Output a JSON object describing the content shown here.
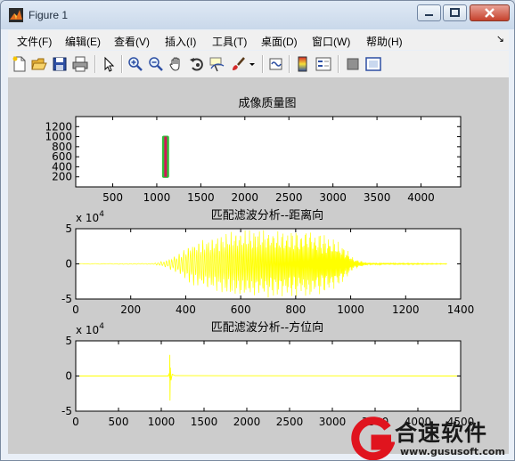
{
  "window": {
    "title": "Figure 1"
  },
  "menu": [
    "文件(F)",
    "编辑(E)",
    "查看(V)",
    "插入(I)",
    "工具(T)",
    "桌面(D)",
    "窗口(W)",
    "帮助(H)"
  ],
  "colors": {
    "signal": "#ffff00",
    "axes_bg": "#ffffff",
    "figure_bg": "#cccccc",
    "image_magenta": "#d4145a",
    "image_green": "#2fbf3a"
  },
  "chart_data": [
    {
      "type": "heatmap",
      "title": "成像质量图",
      "xticks": [
        "500",
        "1000",
        "1500",
        "2000",
        "2500",
        "3000",
        "3500",
        "4000"
      ],
      "yticks": [
        "200",
        "400",
        "600",
        "800",
        "1000",
        "1200"
      ],
      "xlim": [
        80,
        4450
      ],
      "ylim": [
        0,
        1400
      ],
      "blob": {
        "x": [
          1060,
          1140
        ],
        "y": [
          180,
          1020
        ],
        "core_x": [
          1085,
          1115
        ]
      }
    },
    {
      "type": "line",
      "title": "匹配滤波分析--距离向",
      "exponent_label": "x 10",
      "exponent": "4",
      "xticks": [
        "0",
        "200",
        "400",
        "600",
        "800",
        "1000",
        "1200",
        "1400"
      ],
      "yticks": [
        "-5",
        "0",
        "5"
      ],
      "xlim": [
        0,
        1400
      ],
      "ylim": [
        -5,
        5
      ],
      "signal_range": [
        0,
        1350
      ],
      "envelope": [
        [
          0,
          0.04
        ],
        [
          280,
          0.06
        ],
        [
          330,
          0.5
        ],
        [
          380,
          1.6
        ],
        [
          420,
          3.0
        ],
        [
          480,
          3.6
        ],
        [
          520,
          4.0
        ],
        [
          560,
          4.6
        ],
        [
          620,
          4.8
        ],
        [
          700,
          4.8
        ],
        [
          760,
          4.6
        ],
        [
          820,
          4.6
        ],
        [
          880,
          4.4
        ],
        [
          940,
          3.6
        ],
        [
          980,
          2.4
        ],
        [
          1010,
          0.8
        ],
        [
          1060,
          0.15
        ],
        [
          1350,
          0.05
        ]
      ]
    },
    {
      "type": "line",
      "title": "匹配滤波分析--方位向",
      "exponent_label": "x 10",
      "exponent": "4",
      "xticks": [
        "0",
        "500",
        "1000",
        "1500",
        "2000",
        "2500",
        "3000",
        "3500",
        "4000",
        "4500"
      ],
      "yticks": [
        "-5",
        "0",
        "5"
      ],
      "xlim": [
        0,
        4500
      ],
      "ylim": [
        -5,
        5
      ],
      "spike": {
        "x": 1100,
        "up": 3.0,
        "down": -3.5,
        "tail": 0.3
      }
    }
  ],
  "watermark": {
    "brand": "合速软件",
    "url": "www.gususoft.com"
  }
}
